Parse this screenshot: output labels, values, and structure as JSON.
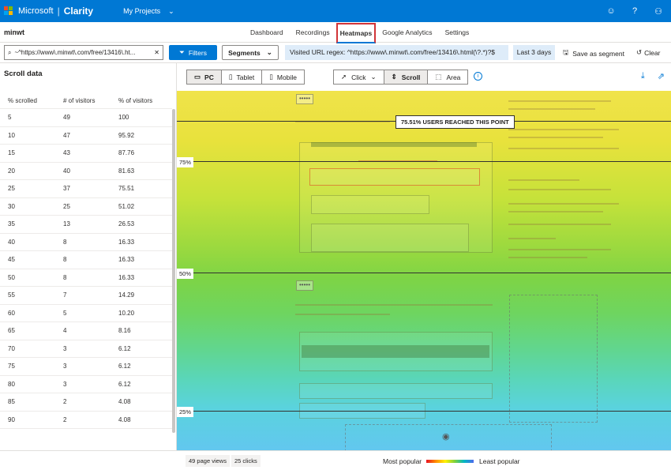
{
  "appbar": {
    "brand": "Microsoft",
    "product": "Clarity",
    "projects_label": "My Projects",
    "right_icons": [
      "smiley-icon",
      "help-icon",
      "user-icon"
    ]
  },
  "nav": {
    "site_name": "minwt",
    "tabs": [
      "Dashboard",
      "Recordings",
      "Heatmaps",
      "Google Analytics",
      "Settings"
    ],
    "active_tab": "Heatmaps"
  },
  "filters": {
    "url_value": "~^https://www\\.minwt\\.com/free/13416\\.ht...",
    "filters_label": "Filters",
    "segments_label": "Segments",
    "url_regex_chip": "Visited URL regex: ^https://www\\.minwt\\.com/free/13416\\.html(\\?.*)?$",
    "date_chip": "Last 3 days",
    "save_segment_label": "Save as segment",
    "clear_label": "Clear"
  },
  "scroll_panel": {
    "title": "Scroll data",
    "headers": [
      "% scrolled",
      "# of visitors",
      "% of visitors"
    ],
    "rows": [
      [
        "5",
        "49",
        "100"
      ],
      [
        "10",
        "47",
        "95.92"
      ],
      [
        "15",
        "43",
        "87.76"
      ],
      [
        "20",
        "40",
        "81.63"
      ],
      [
        "25",
        "37",
        "75.51"
      ],
      [
        "30",
        "25",
        "51.02"
      ],
      [
        "35",
        "13",
        "26.53"
      ],
      [
        "40",
        "8",
        "16.33"
      ],
      [
        "45",
        "8",
        "16.33"
      ],
      [
        "50",
        "8",
        "16.33"
      ],
      [
        "55",
        "7",
        "14.29"
      ],
      [
        "60",
        "5",
        "10.20"
      ],
      [
        "65",
        "4",
        "8.16"
      ],
      [
        "70",
        "3",
        "6.12"
      ],
      [
        "75",
        "3",
        "6.12"
      ],
      [
        "80",
        "3",
        "6.12"
      ],
      [
        "85",
        "2",
        "4.08"
      ],
      [
        "90",
        "2",
        "4.08"
      ]
    ]
  },
  "toolbar": {
    "devices": [
      "PC",
      "Tablet",
      "Mobile"
    ],
    "selected_device": "PC",
    "modes": [
      "Click",
      "Scroll",
      "Area"
    ],
    "selected_mode": "Scroll"
  },
  "heatmap": {
    "reach_badge": "75.51% USERS REACHED THIS POINT",
    "markers": [
      "75%",
      "50%",
      "25%"
    ],
    "handle_glyph": "•••••"
  },
  "footer": {
    "page_views": "49 page views",
    "clicks": "25 clicks",
    "most_popular": "Most popular",
    "least_popular": "Least popular"
  },
  "colors": {
    "brand_blue": "#0078d4",
    "active_tab_outline": "#d13438",
    "chip_bg": "#deecf9"
  }
}
